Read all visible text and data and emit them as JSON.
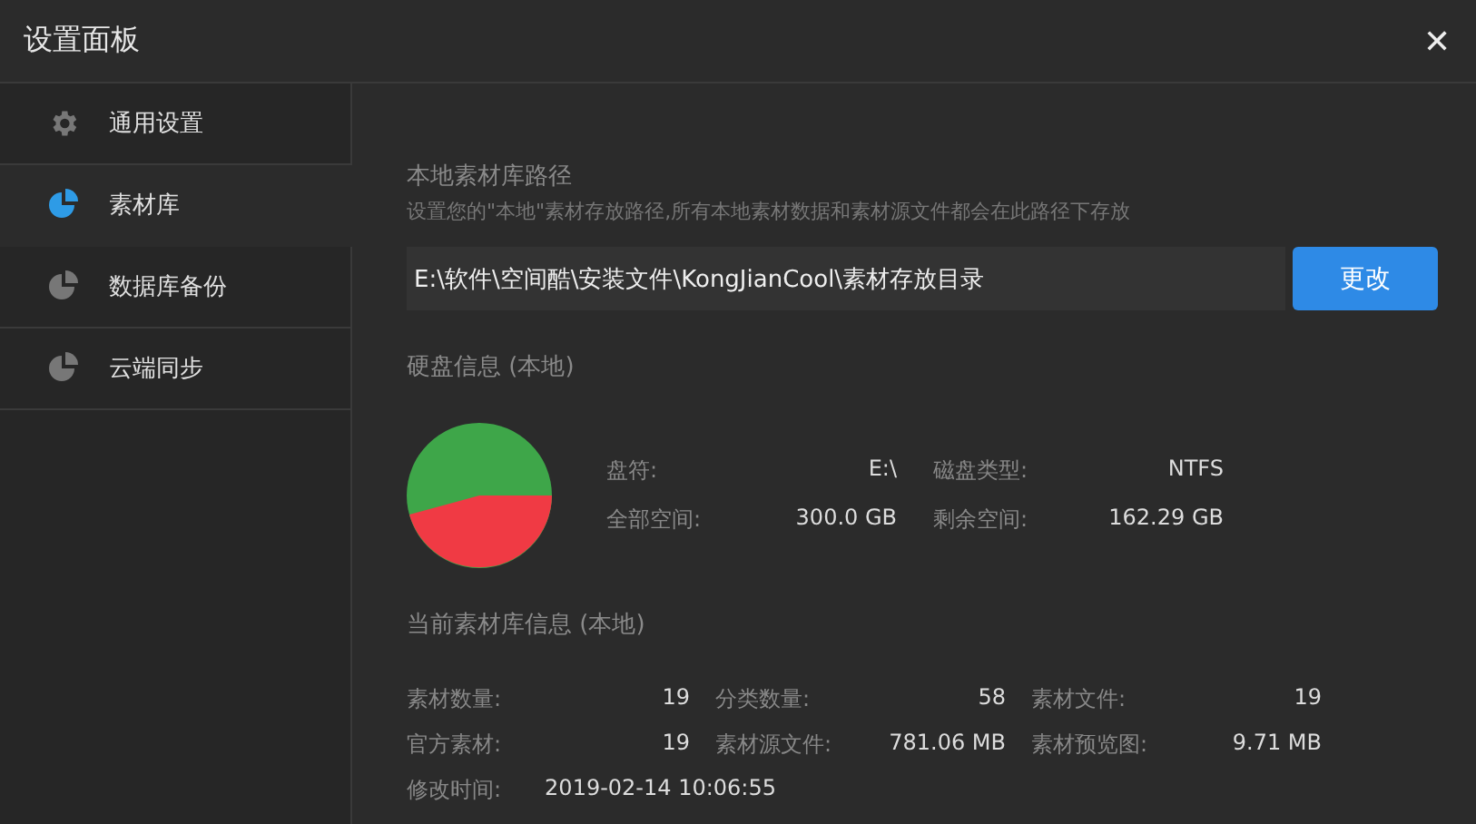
{
  "window": {
    "title": "设置面板",
    "close": "✕"
  },
  "sidebar": {
    "items": [
      {
        "label": "通用设置",
        "kind": "gear",
        "selected": false
      },
      {
        "label": "素材库",
        "kind": "pie",
        "selected": true
      },
      {
        "label": "数据库备份",
        "kind": "pie",
        "selected": false
      },
      {
        "label": "云端同步",
        "kind": "pie",
        "selected": false
      }
    ]
  },
  "path": {
    "title": "本地素材库路径",
    "hint": "设置您的\"本地\"素材存放路径,所有本地素材数据和素材源文件都会在此路径下存放",
    "value": "E:\\软件\\空间酷\\安装文件\\KongJianCool\\素材存放目录",
    "button": "更改"
  },
  "disk": {
    "title": "硬盘信息 (本地)",
    "fields": [
      {
        "label": "盘符:",
        "value": "E:\\"
      },
      {
        "label": "磁盘类型:",
        "value": "NTFS"
      },
      {
        "label": "全部空间:",
        "value": "300.0 GB"
      },
      {
        "label": "剩余空间:",
        "value": "162.29 GB"
      }
    ]
  },
  "library": {
    "title": "当前素材库信息 (本地)",
    "fields": [
      {
        "label": "素材数量:",
        "value": "19"
      },
      {
        "label": "分类数量:",
        "value": "58"
      },
      {
        "label": "素材文件:",
        "value": "19"
      },
      {
        "label": "官方素材:",
        "value": "19"
      },
      {
        "label": "素材源文件:",
        "value": "781.06 MB"
      },
      {
        "label": "素材预览图:",
        "value": "9.71 MB"
      }
    ],
    "modified": {
      "label": "修改时间:",
      "value": "2019-02-14 10:06:55"
    }
  }
}
